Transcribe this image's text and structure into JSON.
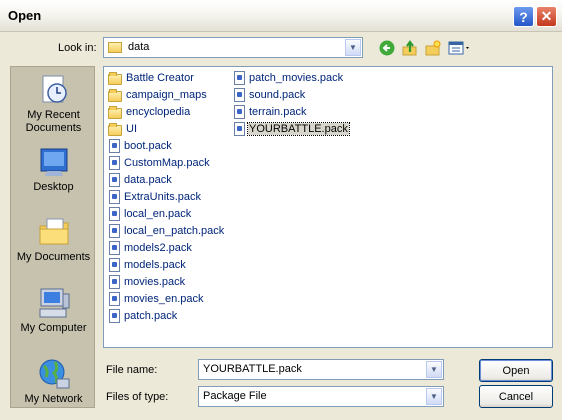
{
  "window": {
    "title": "Open"
  },
  "title_buttons": {
    "help": "?",
    "close": "✕"
  },
  "look_in": {
    "label": "Look in:",
    "value": "data"
  },
  "toolbar": {
    "back_icon": "back-arrow-icon",
    "up_icon": "up-folder-icon",
    "new_folder_icon": "new-folder-icon",
    "views_icon": "views-menu-icon"
  },
  "places": [
    {
      "label": "My Recent Documents",
      "icon": "recent-documents-icon"
    },
    {
      "label": "Desktop",
      "icon": "desktop-icon"
    },
    {
      "label": "My Documents",
      "icon": "my-documents-icon"
    },
    {
      "label": "My Computer",
      "icon": "my-computer-icon"
    },
    {
      "label": "My Network",
      "icon": "my-network-icon"
    }
  ],
  "files": [
    {
      "name": "Battle Creator",
      "type": "folder"
    },
    {
      "name": "campaign_maps",
      "type": "folder"
    },
    {
      "name": "encyclopedia",
      "type": "folder"
    },
    {
      "name": "UI",
      "type": "folder"
    },
    {
      "name": "boot.pack",
      "type": "file"
    },
    {
      "name": "CustomMap.pack",
      "type": "file"
    },
    {
      "name": "data.pack",
      "type": "file"
    },
    {
      "name": "ExtraUnits.pack",
      "type": "file"
    },
    {
      "name": "local_en.pack",
      "type": "file"
    },
    {
      "name": "local_en_patch.pack",
      "type": "file"
    },
    {
      "name": "models2.pack",
      "type": "file"
    },
    {
      "name": "models.pack",
      "type": "file"
    },
    {
      "name": "movies.pack",
      "type": "file"
    },
    {
      "name": "movies_en.pack",
      "type": "file"
    },
    {
      "name": "patch.pack",
      "type": "file"
    },
    {
      "name": "patch_movies.pack",
      "type": "file"
    },
    {
      "name": "sound.pack",
      "type": "file"
    },
    {
      "name": "terrain.pack",
      "type": "file"
    },
    {
      "name": "YOURBATTLE.pack",
      "type": "file",
      "selected": true
    }
  ],
  "file_name": {
    "label": "File name:",
    "value": "YOURBATTLE.pack"
  },
  "file_type": {
    "label": "Files of type:",
    "value": "Package File"
  },
  "buttons": {
    "open": "Open",
    "cancel": "Cancel"
  }
}
